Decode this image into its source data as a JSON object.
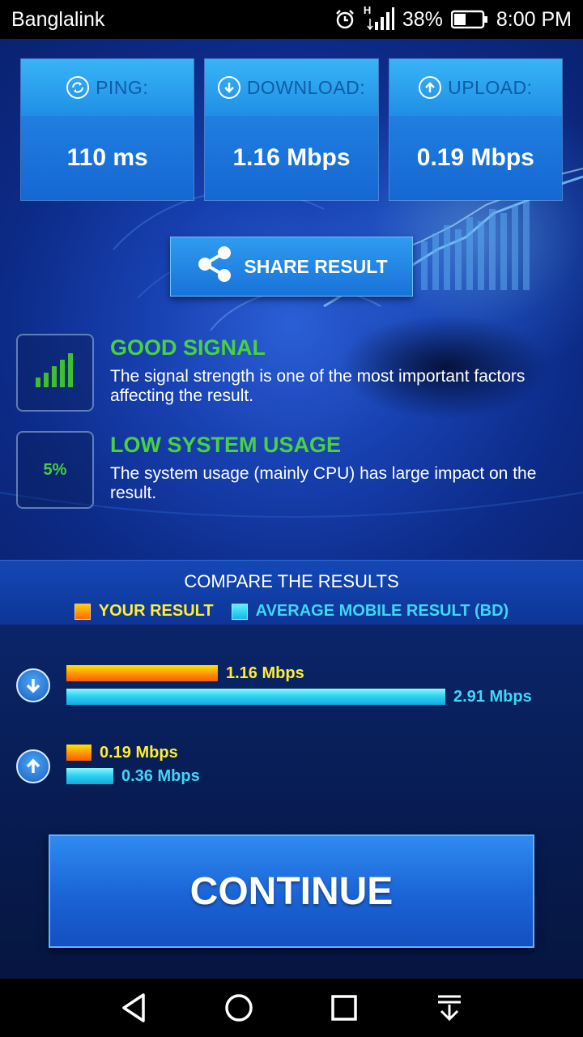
{
  "status_bar": {
    "carrier": "Banglalink",
    "network_type": "H",
    "battery": "38%",
    "time": "8:00 PM"
  },
  "metrics": [
    {
      "label": "PING:",
      "value": "110 ms",
      "icon": "ping-arrows-icon"
    },
    {
      "label": "DOWNLOAD:",
      "value": "1.16 Mbps",
      "icon": "download-arrow-icon"
    },
    {
      "label": "UPLOAD:",
      "value": "0.19 Mbps",
      "icon": "upload-arrow-icon"
    }
  ],
  "share": {
    "label": "SHARE RESULT"
  },
  "signal": {
    "title": "GOOD SIGNAL",
    "description": "The signal strength is one of the most important factors affecting the result."
  },
  "system": {
    "usage": "5%",
    "title": "LOW SYSTEM USAGE",
    "description": "The system usage (mainly CPU) has large impact on the result."
  },
  "compare": {
    "title": "COMPARE THE RESULTS",
    "legend_yours": "YOUR RESULT",
    "legend_average": "AVERAGE MOBILE RESULT (BD)",
    "colors": {
      "yours": "#ff9a00",
      "average": "#2fd4f2",
      "yours_text": "#ffee33",
      "average_text": "#3fd7f5"
    }
  },
  "chart_data": {
    "type": "bar",
    "categories": [
      "download",
      "upload"
    ],
    "series": [
      {
        "name": "YOUR RESULT",
        "values": [
          1.16,
          0.19
        ],
        "labels": [
          "1.16 Mbps",
          "0.19 Mbps"
        ]
      },
      {
        "name": "AVERAGE MOBILE RESULT (BD)",
        "values": [
          2.91,
          0.36
        ],
        "labels": [
          "2.91 Mbps",
          "0.36 Mbps"
        ]
      }
    ],
    "unit": "Mbps"
  },
  "continue": {
    "label": "CONTINUE"
  },
  "colors": {
    "accent_green": "#4ad23c",
    "card_head": "#39b4f6",
    "button_blue": "#1a63d6"
  }
}
